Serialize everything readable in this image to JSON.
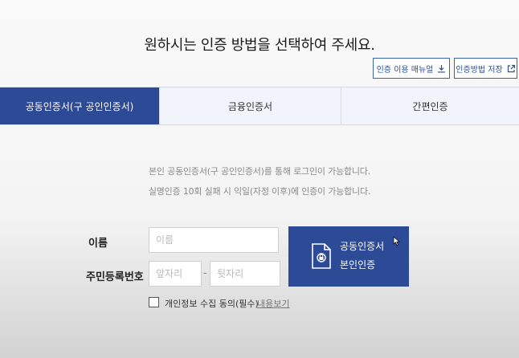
{
  "header": {
    "title": "원하시는 인증 방법을 선택하여 주세요."
  },
  "utility": {
    "manual_label": "인증 이용 매뉴얼",
    "save_label": "인증방법 저장"
  },
  "tabs": [
    {
      "label": "공동인증서(구 공인인증서)",
      "active": true
    },
    {
      "label": "금융인증서",
      "active": false
    },
    {
      "label": "간편인증",
      "active": false
    }
  ],
  "info": {
    "line1": "본인 공동인증서(구 공인인증서)를 통해 로그인이 가능합니다.",
    "line2": "실명인증 10회 실패 시 익일(자정 이후)에 인증이 가능합니다."
  },
  "form": {
    "name_label": "이름",
    "name_placeholder": "이름",
    "rrn_label": "주민등록번호",
    "rrn_front_placeholder": "앞자리",
    "rrn_separator": "-",
    "rrn_back_placeholder": "뒷자리"
  },
  "cert_button": {
    "line1": "공동인증서",
    "line2": "본인인증"
  },
  "consent": {
    "label": "개인정보 수집 동의(필수)",
    "view_label": "내용보기"
  },
  "colors": {
    "primary": "#2c4a96",
    "tab_bg": "#f1f4fa",
    "border": "#d6dbe6"
  }
}
